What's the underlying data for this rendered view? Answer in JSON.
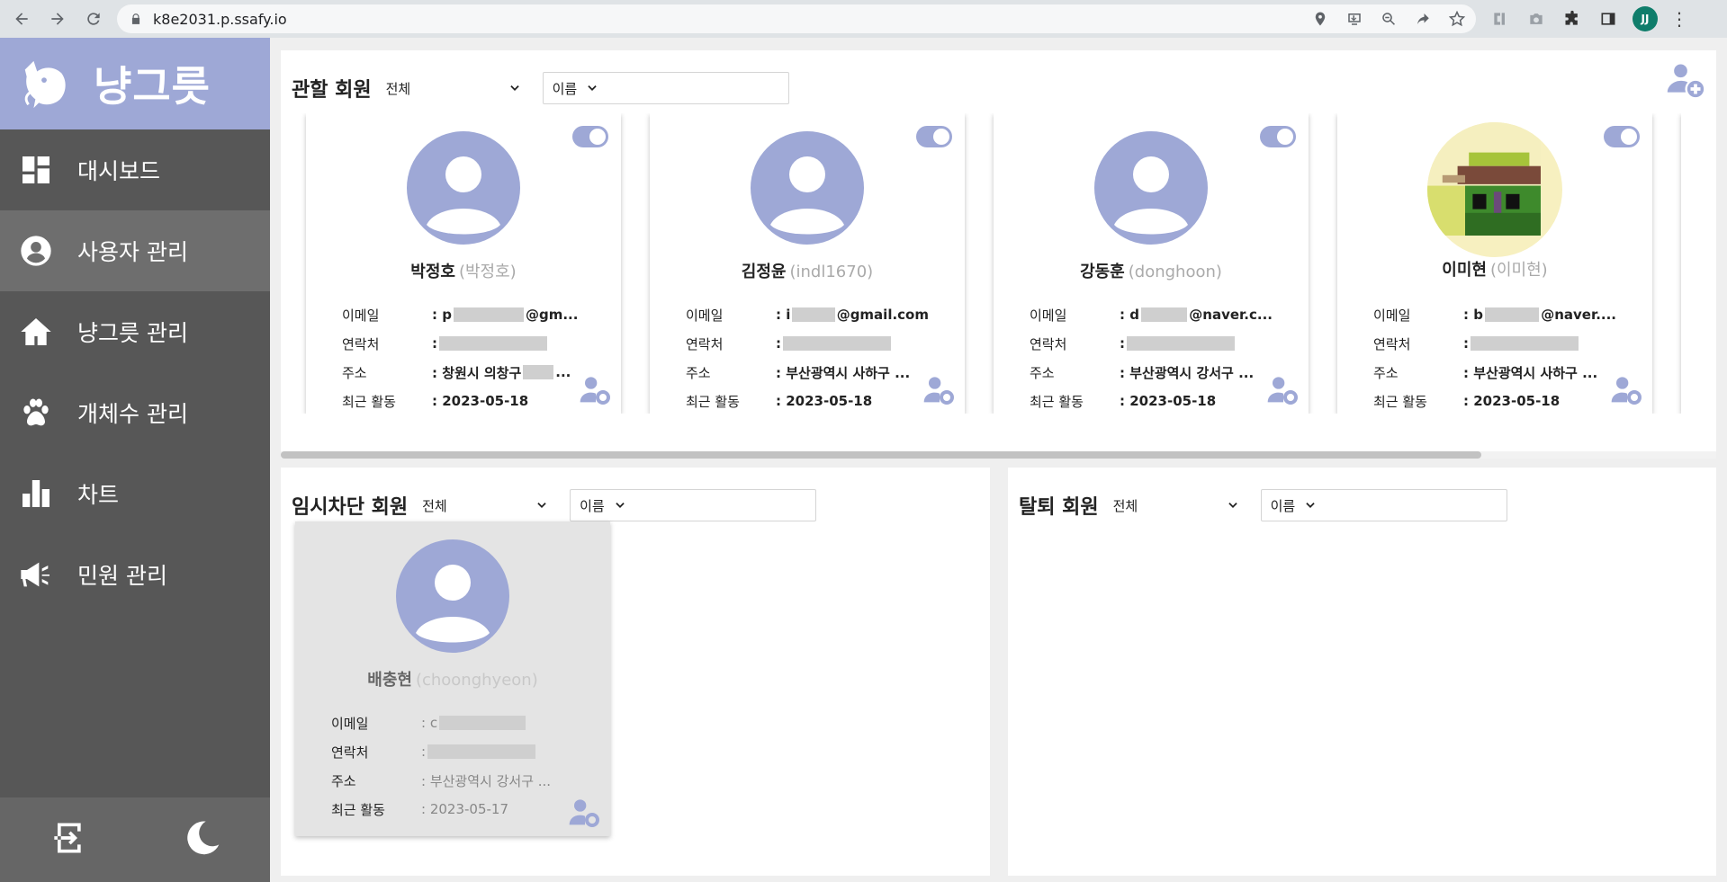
{
  "browser": {
    "url": "k8e2031.p.ssafy.io",
    "profile_initials": "JJ"
  },
  "sidebar": {
    "brand": "냥그릇",
    "items": [
      {
        "label": "대시보드",
        "icon": "dashboard-icon"
      },
      {
        "label": "사용자 관리",
        "icon": "user-circle-icon"
      },
      {
        "label": "냥그릇 관리",
        "icon": "home-icon"
      },
      {
        "label": "개체수 관리",
        "icon": "paw-icon"
      },
      {
        "label": "차트",
        "icon": "bar-chart-icon"
      },
      {
        "label": "민원 관리",
        "icon": "megaphone-icon"
      }
    ],
    "active_index": 1
  },
  "accent_color": "#9ea8d6",
  "managed": {
    "title": "관할 회원",
    "filter": "전체",
    "search_field": "이름",
    "cards": [
      {
        "name": "박정호",
        "nick": "(박정호)",
        "email_pre": "p",
        "email_post": "@gm...",
        "address": ": 창원시 의창구",
        "address_tail": "...",
        "recent": ": 2023-05-18"
      },
      {
        "name": "김정윤",
        "nick": "(indl1670)",
        "email_pre": "i",
        "email_post": "@gmail.com",
        "address": ": 부산광역시 사하구 ...",
        "address_tail": "",
        "recent": ": 2023-05-18"
      },
      {
        "name": "강동훈",
        "nick": "(donghoon)",
        "email_pre": "d",
        "email_post": "@naver.c...",
        "address": ": 부산광역시 강서구 ...",
        "address_tail": "",
        "recent": ": 2023-05-18"
      },
      {
        "name": "이미현",
        "nick": "(이미현)",
        "email_pre": "b",
        "email_post": "@naver....",
        "address": ": 부산광역시 사하구 ...",
        "address_tail": "",
        "recent": ": 2023-05-18"
      }
    ]
  },
  "labels": {
    "email": "이메일",
    "phone": "연락처",
    "address": "주소",
    "recent": "최근 활동",
    "colon": ":"
  },
  "blocked": {
    "title": "임시차단 회원",
    "filter": "전체",
    "search_field": "이름",
    "cards": [
      {
        "name": "배충현",
        "nick": "(choonghyeon)",
        "email_pre": "c",
        "address": ": 부산광역시 강서구 ...",
        "recent": ": 2023-05-17"
      }
    ]
  },
  "withdrawn": {
    "title": "탈퇴 회원",
    "filter": "전체",
    "search_field": "이름"
  }
}
